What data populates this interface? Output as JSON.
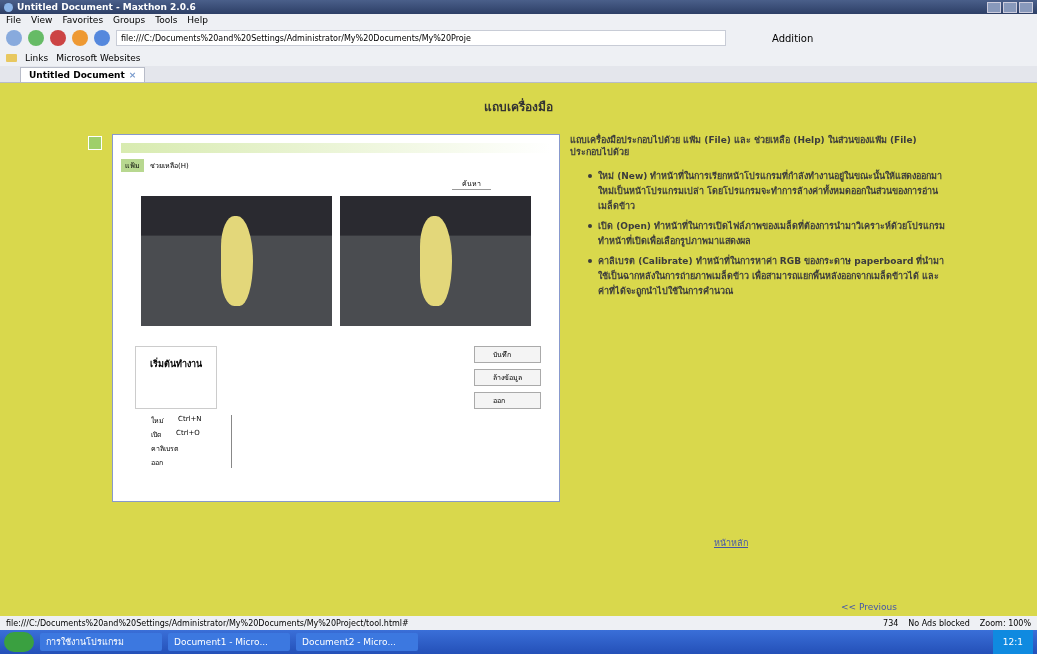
{
  "window": {
    "title": "Untitled Document - Maxthon 2.0.6"
  },
  "menu": [
    "File",
    "View",
    "Favorites",
    "Groups",
    "Tools",
    "Help"
  ],
  "address": {
    "value": "file:///C:/Documents%20and%20Settings/Administrator/My%20Documents/My%20Proje"
  },
  "search_label": "Addition",
  "links_bar": [
    "Links",
    "Microsoft Websites"
  ],
  "tabs": [
    {
      "label": "Untitled Document",
      "close": "×",
      "selected": true
    }
  ],
  "page": {
    "heading": "แถบเครื่องมือ",
    "intro": "แถบเครื่องมือประกอบไปด้วย แฟ้ม (File) และ ช่วยเหลือ (Help) ในส่วนของแฟ้ม (File) ประกอบไปด้วย",
    "bullets": [
      "ใหม่ (New) ทำหน้าที่ในการเรียกหน้าโปรแกรมที่กำลังทำงานอยู่ในขณะนั้นให้แสดงออกมาใหม่เป็นหน้าโปรแกรมเปล่า โดยโปรแกรมจะทำการล้างค่าทั้งหมดออกในส่วนของการอ่านเมล็ดข้าว",
      "เปิด (Open) ทำหน้าที่ในการเปิดไฟล์ภาพของเมล็ดที่ต้องการนำมาวิเคราะห์ด้วยโปรแกรม ทำหน้าที่เปิดเพื่อเลือกรูปภาพมาแสดงผล",
      "คาลิเบรต (Calibrate) ทำหน้าที่ในการหาค่า RGB ของกระดาษ paperboard ที่นำมาใช้เป็นฉากหลังในการถ่ายภาพเมล็ดข้าว เพื่อสามารถแยกพื้นหลังออกจากเมล็ดข้าวได้ และค่าที่ได้จะถูกนำไปใช้ในการคำนวณ"
    ],
    "home_link": "หน้าหลัก",
    "previous_link": "<< Previous",
    "inset": {
      "search_button": "ค้นหา",
      "start_label": "เริ่มต้นทำงาน",
      "buttons": [
        "บันทึก",
        "ล้างข้อมูล",
        "ออก"
      ],
      "menu": [
        "แฟ้ม",
        "ช่วยเหลือ(H)"
      ],
      "menu_items": [
        {
          "label": "ใหม่",
          "shortcut": "Ctrl+N"
        },
        {
          "label": "เปิด",
          "shortcut": "Ctrl+O"
        },
        {
          "label": "คาลิเบรต"
        },
        {
          "label": "ออก"
        }
      ]
    }
  },
  "status_bar": {
    "url": "file:///C:/Documents%20and%20Settings/Administrator/My%20Documents/My%20Project/tool.html#",
    "count": "734",
    "ads": "No Ads blocked",
    "zoom": "Zoom: 100%"
  },
  "taskbar": {
    "items": [
      {
        "label": "การใช้งานโปรแกรม",
        "selected": false
      },
      {
        "label": "Document1 - Micro...",
        "selected": false
      },
      {
        "label": "Document2 - Micro...",
        "selected": false
      }
    ],
    "clock": "12:1"
  }
}
